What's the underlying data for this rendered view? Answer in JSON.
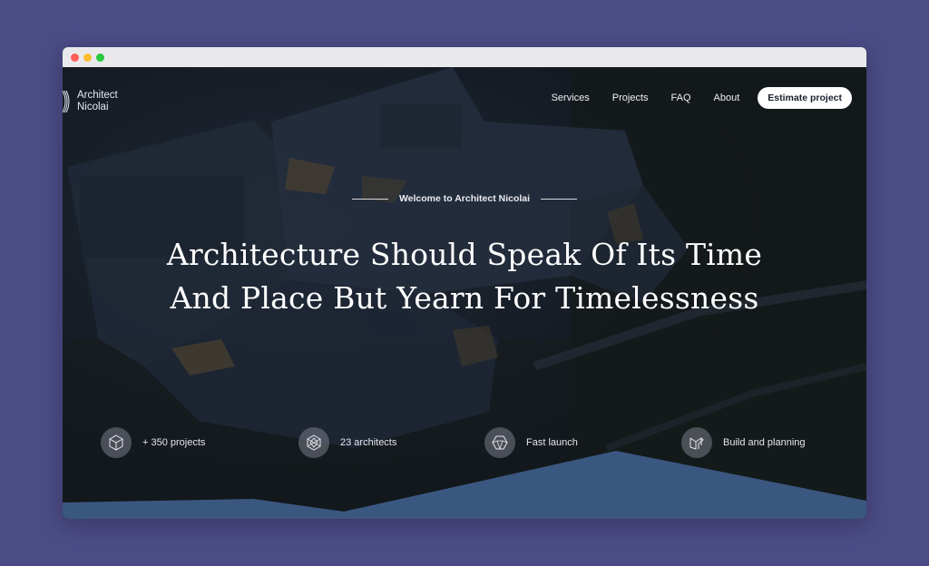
{
  "brand": {
    "line1": "Architect",
    "line2": "Nicolai"
  },
  "nav": {
    "items": [
      "Services",
      "Projects",
      "FAQ",
      "About"
    ],
    "cta": "Estimate project"
  },
  "hero": {
    "eyebrow": "Welcome to Architect Nicolai",
    "headline_line1": "Architecture Should Speak Of Its Time",
    "headline_line2": "And Place But Yearn For Timelessness"
  },
  "stats": [
    {
      "icon": "cube-icon",
      "label": "+ 350 projects"
    },
    {
      "icon": "geo-sphere-icon",
      "label": "23 architects"
    },
    {
      "icon": "polyhedron-icon",
      "label": "Fast launch"
    },
    {
      "icon": "blocks-icon",
      "label": "Build and planning"
    }
  ],
  "colors": {
    "page_bg": "#4b4b86",
    "wave": "#3a5780",
    "cta_bg": "#ffffff"
  }
}
